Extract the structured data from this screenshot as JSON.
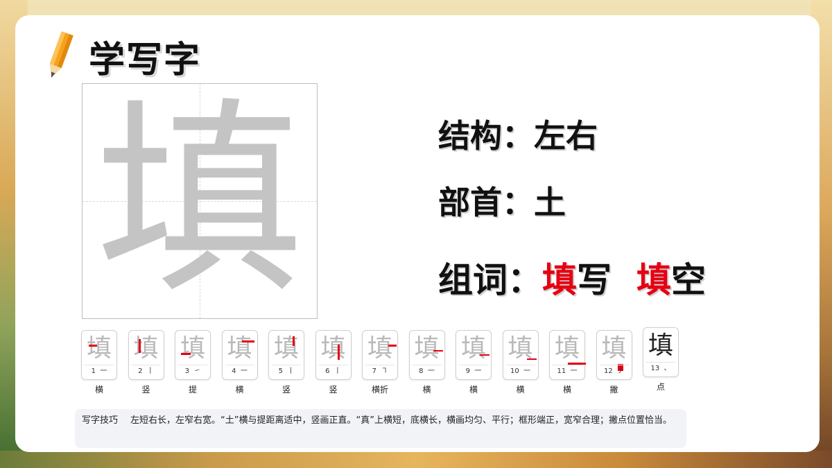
{
  "title": "学写字",
  "character": "填",
  "structure": {
    "label": "结构：",
    "value": "左右"
  },
  "radical": {
    "label": "部首：",
    "value": "土"
  },
  "words": {
    "label": "组词：",
    "items": [
      {
        "highlight": "填",
        "rest": "写"
      },
      {
        "highlight": "填",
        "rest": "空"
      }
    ]
  },
  "colors": {
    "highlight": "#e60012",
    "ghost": "#c4c4c4"
  },
  "strokes": [
    {
      "num": "1",
      "sym": "一",
      "name": "横"
    },
    {
      "num": "2",
      "sym": "丨",
      "name": "竖"
    },
    {
      "num": "3",
      "sym": "㇀",
      "name": "提"
    },
    {
      "num": "4",
      "sym": "一",
      "name": "横"
    },
    {
      "num": "5",
      "sym": "丨",
      "name": "竖"
    },
    {
      "num": "6",
      "sym": "丨",
      "name": "竖"
    },
    {
      "num": "7",
      "sym": "㇕",
      "name": "横折"
    },
    {
      "num": "8",
      "sym": "一",
      "name": "横"
    },
    {
      "num": "9",
      "sym": "一",
      "name": "横"
    },
    {
      "num": "10",
      "sym": "一",
      "name": "横"
    },
    {
      "num": "11",
      "sym": "一",
      "name": "横"
    },
    {
      "num": "12",
      "sym": "丿",
      "name": "撇"
    },
    {
      "num": "13",
      "sym": "、",
      "name": "点"
    }
  ],
  "tip": {
    "label": "写字技巧",
    "text": "左短右长，左窄右宽。“土”横与提距离适中，竖画正直。“真”上横短，底横长，横画均匀、平行；框形端正，宽窄合理；撇点位置恰当。"
  }
}
